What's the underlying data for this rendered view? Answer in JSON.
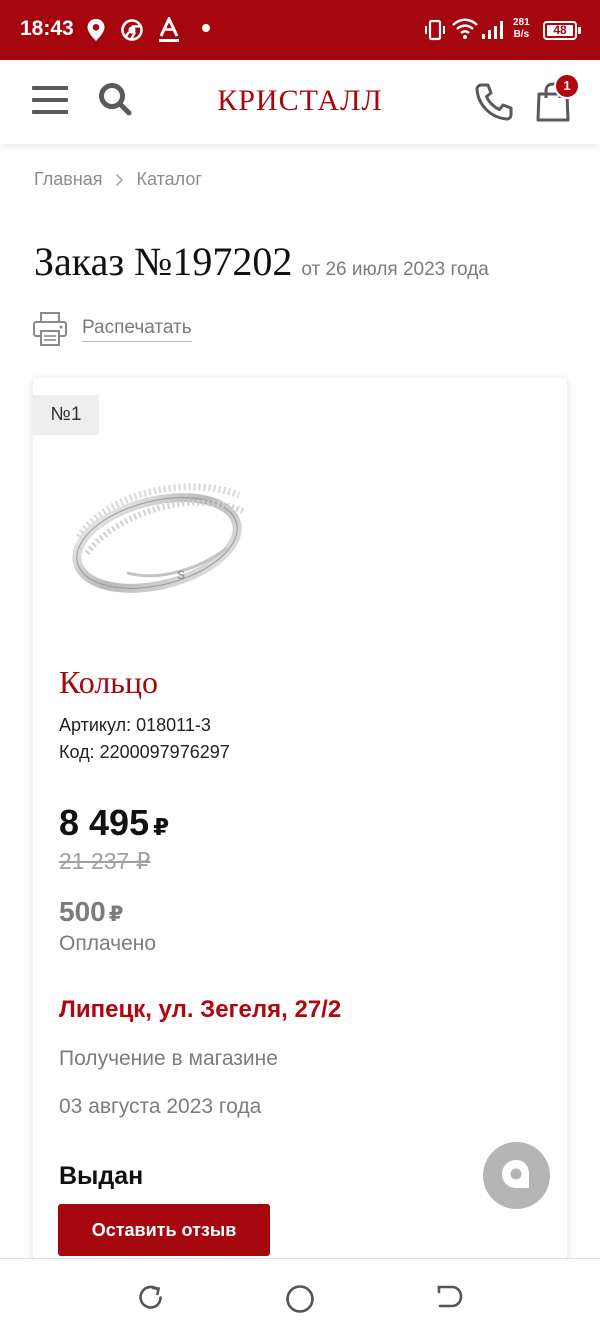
{
  "status_bar": {
    "time": "18:43",
    "network_speed_value": "281",
    "network_speed_unit": "B/s",
    "battery": "48"
  },
  "header": {
    "logo": "КРИСТАЛЛ",
    "cart_count": "1"
  },
  "breadcrumb": {
    "items": [
      "Главная",
      "Каталог"
    ]
  },
  "order": {
    "title": "Заказ №197202",
    "date": "от 26 июля 2023 года",
    "print_label": "Распечатать"
  },
  "item": {
    "number": "№1",
    "name": "Кольцо",
    "sku": "Артикул: 018011-3",
    "code": "Код: 2200097976297",
    "price": "8 495",
    "currency": "₽",
    "old_price": "21 237 ₽",
    "paid_amount": "500",
    "paid_label": "Оплачено",
    "store": "Липецк, ул. Зегеля, 27/2",
    "delivery_method": "Получение в магазине",
    "delivery_date": "03 августа 2023 года",
    "status": "Выдан",
    "review_button": "Оставить отзыв"
  },
  "colors": {
    "brand": "#a6070f",
    "status_bar": "#a6070f",
    "muted_text": "#7c7c7c"
  },
  "icons": {
    "menu": "hamburger-menu-icon",
    "search": "search-icon",
    "phone": "phone-icon",
    "cart": "shopping-bag-icon",
    "print": "printer-icon",
    "chat": "chat-icon"
  }
}
